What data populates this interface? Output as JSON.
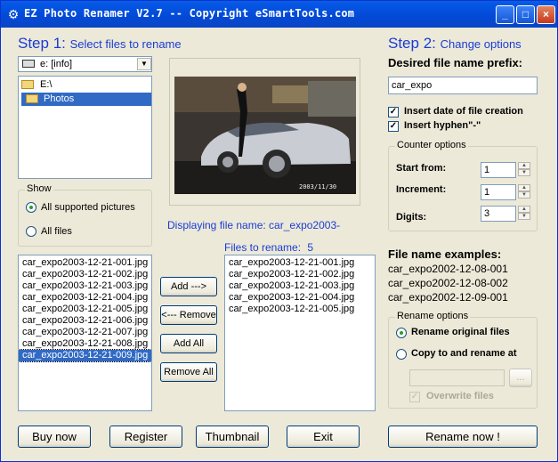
{
  "window": {
    "title": "EZ Photo Renamer V2.7 -- Copyright eSmartTools.com",
    "minimize_label": "_",
    "maximize_label": "□",
    "close_label": "×"
  },
  "step1": {
    "prefix": "Step 1:",
    "subtitle": "Select files to rename",
    "drive_value": "e: [info]",
    "folders": [
      "E:\\",
      "Photos"
    ]
  },
  "show": {
    "title": "Show",
    "options": [
      "All supported pictures",
      "All files"
    ],
    "selected": 0
  },
  "preview": {
    "displaying_label": "Displaying file name: car_expo2003-",
    "photo_timestamp": "2003/11/30",
    "files_to_rename_label": "Files to rename:",
    "files_to_rename_count": "5"
  },
  "source_files": [
    "car_expo2003-12-21-001.jpg",
    "car_expo2003-12-21-002.jpg",
    "car_expo2003-12-21-003.jpg",
    "car_expo2003-12-21-004.jpg",
    "car_expo2003-12-21-005.jpg",
    "car_expo2003-12-21-006.jpg",
    "car_expo2003-12-21-007.jpg",
    "car_expo2003-12-21-008.jpg",
    "car_expo2003-12-21-009.jpg"
  ],
  "selected_source_index": 8,
  "rename_files": [
    "car_expo2003-12-21-001.jpg",
    "car_expo2003-12-21-002.jpg",
    "car_expo2003-12-21-003.jpg",
    "car_expo2003-12-21-004.jpg",
    "car_expo2003-12-21-005.jpg"
  ],
  "buttons": {
    "add": "Add --->",
    "remove": "<--- Remove",
    "add_all": "Add All",
    "remove_all": "Remove All",
    "buy_now": "Buy now",
    "register": "Register",
    "thumbnail": "Thumbnail",
    "exit": "Exit",
    "rename_now": "Rename now !",
    "browse": "..."
  },
  "step2": {
    "prefix": "Step 2:",
    "subtitle": "Change options",
    "prefix_label": "Desired file name prefix:",
    "prefix_value": "car_expo",
    "insert_date_label": "Insert date of file creation",
    "insert_date_checked": true,
    "insert_hyphen_label": "Insert hyphen\"-\"",
    "insert_hyphen_checked": true
  },
  "counter": {
    "title": "Counter options",
    "start_label": "Start from:",
    "start_value": "1",
    "increment_label": "Increment:",
    "increment_value": "1",
    "digits_label": "Digits:",
    "digits_value": "3"
  },
  "examples": {
    "title": "File name examples:",
    "items": [
      "car_expo2002-12-08-001",
      "car_expo2002-12-08-002",
      "car_expo2002-12-09-001"
    ]
  },
  "rename_options": {
    "title": "Rename options",
    "original_label": "Rename original files",
    "copy_label": "Copy to and rename at",
    "selected": 0,
    "copy_path_value": "",
    "overwrite_label": "Overwrite files",
    "overwrite_checked": true
  },
  "colors": {
    "accent_blue": "#1a3cd6",
    "selection": "#316ac5",
    "window_bg": "#ece9d8"
  }
}
